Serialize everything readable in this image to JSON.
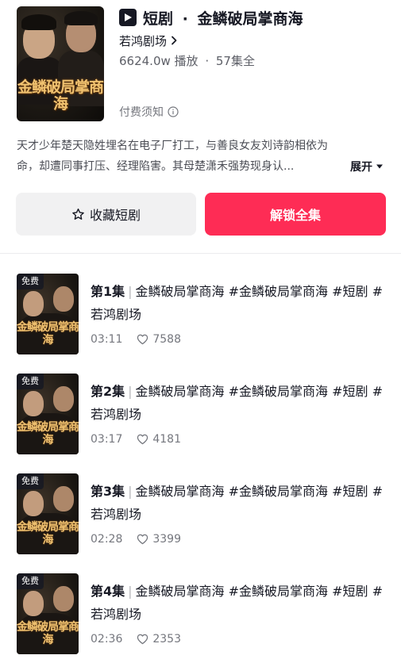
{
  "drama": {
    "type_label": "短剧",
    "separator": "·",
    "name": "金鳞破局掌商海",
    "cover_title": "金鳞破局掌商海",
    "theater": "若鸿剧场",
    "plays": "6624.0w 播放",
    "episodes_total": "57集全",
    "stats_sep": "·",
    "notice": "付费须知",
    "description_line1": "天才少年楚天隐姓埋名在电子厂打工，与善良女友刘诗韵相依为",
    "description_line2": "命，却遭同事打压、经理陷害。其母楚潇禾强势现身认...",
    "expand_label": "展开"
  },
  "buttons": {
    "favorite": "收藏短剧",
    "unlock": "解锁全集"
  },
  "colors": {
    "accent": "#fe2c55",
    "text_primary": "#161823",
    "text_secondary": "#75777e"
  },
  "episodes": [
    {
      "free": "免费",
      "number": "第1集",
      "text": "金鳞破局掌商海 #金鳞破局掌商海 #短剧 #若鸿剧场",
      "duration": "03:11",
      "likes": "7588",
      "thumb_title": "金鳞破局掌商海"
    },
    {
      "free": "免费",
      "number": "第2集",
      "text": "金鳞破局掌商海 #金鳞破局掌商海 #短剧 #若鸿剧场",
      "duration": "03:17",
      "likes": "4181",
      "thumb_title": "金鳞破局掌商海"
    },
    {
      "free": "免费",
      "number": "第3集",
      "text": "金鳞破局掌商海 #金鳞破局掌商海 #短剧 #若鸿剧场",
      "duration": "02:28",
      "likes": "3399",
      "thumb_title": "金鳞破局掌商海"
    },
    {
      "free": "免费",
      "number": "第4集",
      "text": "金鳞破局掌商海 #金鳞破局掌商海 #短剧 #若鸿剧场",
      "duration": "02:36",
      "likes": "2353",
      "thumb_title": "金鳞破局掌商海"
    }
  ],
  "icons": {
    "play": "play-badge-icon",
    "chevron": "chevron-right-icon",
    "info": "info-circle-icon",
    "expand": "triangle-down-icon",
    "star": "star-outline-icon",
    "heart": "heart-outline-icon"
  }
}
